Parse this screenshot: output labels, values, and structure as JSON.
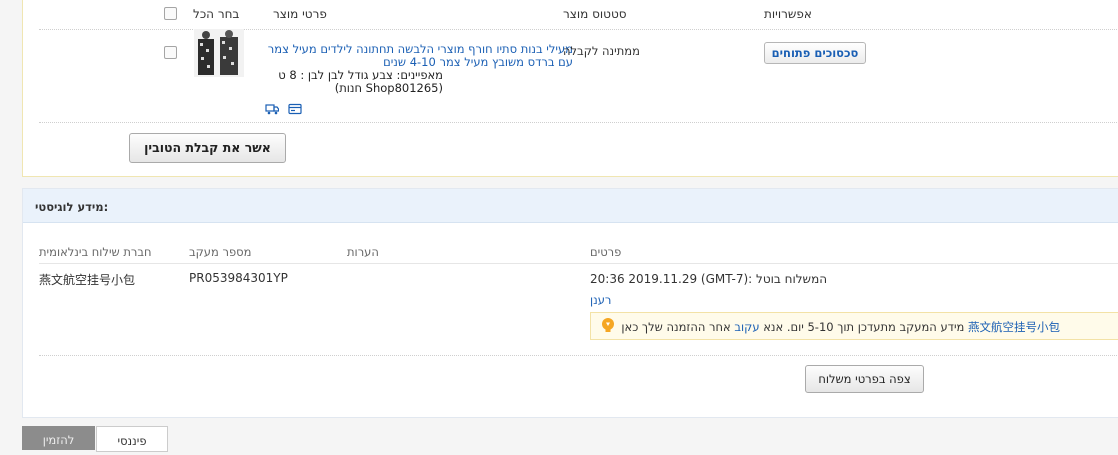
{
  "order": {
    "headers": {
      "options": "אפשרויות",
      "status": "סטטוס מוצר",
      "details": "פרטי מוצר",
      "select_all": "בחר הכל"
    },
    "item": {
      "title": "מעילי בנות סתיו חורף מוצרי הלבשה תחתונה לילדים מעיל צמר עם ברדס משובץ מעיל צמר 4-10 שנים",
      "attributes": "מאפיינים: צבע גודל לבן לבן : 8 ט",
      "shop": "(Shop801265 חנות)",
      "status": "ממתינה לקבלה",
      "disputes_button": "סכסוכים פתוחים"
    },
    "confirm_button": "אשר את קבלת הטובין"
  },
  "logistics": {
    "title": "מידע לוגיסטי:",
    "columns": {
      "carrier": "חברת שילוח בינלאומית",
      "tracking": "מספר מעקב",
      "notes": "הערות",
      "details": "פרטים"
    },
    "row": {
      "carrier": "燕文航空挂号小包",
      "tracking": "PR053984301YP",
      "event": "המשלוח בוטל :(GMT-7) 20:36 2019.11.29",
      "refresh_link": "רענן"
    },
    "tip": {
      "carrier_link": "燕文航空挂号小包",
      "text_before": "מידע המעקב מתעדכן תוך 5-10 יום. אנא",
      "follow_link": "עקוב",
      "text_after": "אחר ההזמנה שלך כאן"
    },
    "details_button": "צפה בפרטי משלוח"
  },
  "bottom_tabs": {
    "dark": "להזמין",
    "light": "פיננסי"
  },
  "colors": {
    "link": "#1a5fb4",
    "header_bg": "#eaf2fb",
    "tip_bg": "#fffbea",
    "bulb": "#f5a623"
  }
}
